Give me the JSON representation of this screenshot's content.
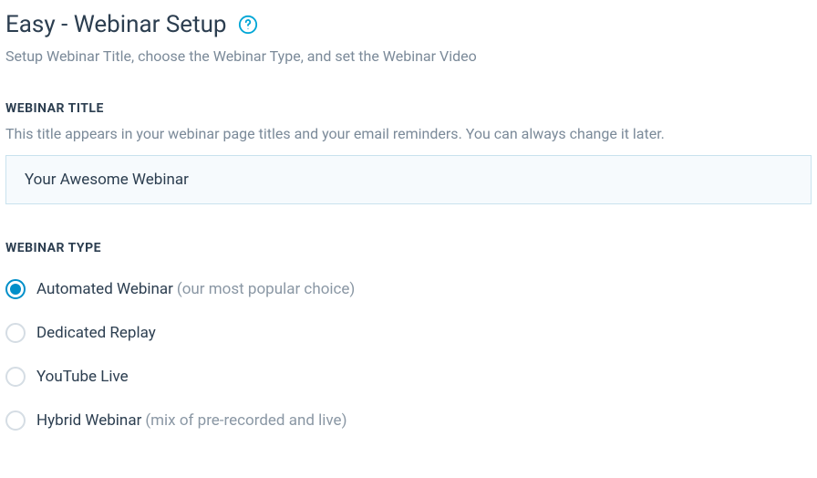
{
  "header": {
    "title": "Easy - Webinar Setup",
    "subtitle": "Setup Webinar Title, choose the Webinar Type, and set the Webinar Video"
  },
  "title_section": {
    "label": "WEBINAR TITLE",
    "help": "This title appears in your webinar page titles and your email reminders. You can always change it later.",
    "value": "Your Awesome Webinar"
  },
  "type_section": {
    "label": "WEBINAR TYPE",
    "options": [
      {
        "label": "Automated Webinar",
        "hint": "(our most popular choice)",
        "selected": true
      },
      {
        "label": "Dedicated Replay",
        "hint": "",
        "selected": false
      },
      {
        "label": "YouTube Live",
        "hint": "",
        "selected": false
      },
      {
        "label": "Hybrid Webinar",
        "hint": "(mix of pre-recorded and live)",
        "selected": false
      }
    ]
  }
}
